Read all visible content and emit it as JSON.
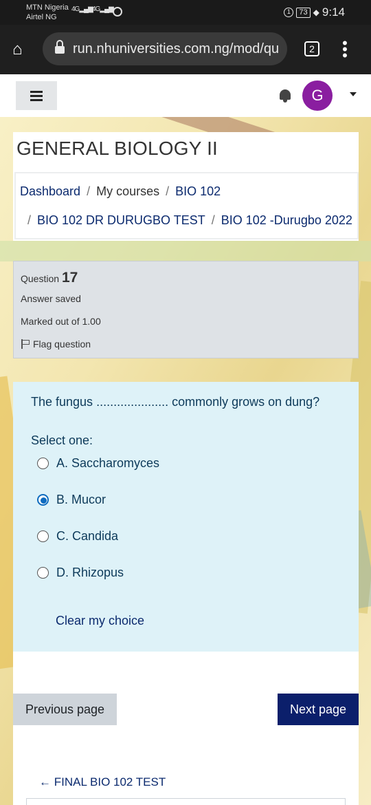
{
  "status_bar": {
    "carrier1": "MTN Nigeria",
    "carrier2": "Airtel NG",
    "signal1": "4G",
    "signal2": "4G",
    "battery": "73",
    "time": "9:14"
  },
  "browser": {
    "url": "run.nhuniversities.com.ng/mod/qu",
    "tab_count": "2"
  },
  "navbar": {
    "avatar_letter": "G"
  },
  "page": {
    "title": "GENERAL BIOLOGY II",
    "breadcrumb": [
      "Dashboard",
      "My courses",
      "BIO 102",
      "BIO 102 DR DURUGBO TEST",
      "BIO 102 -Durugbo 2022"
    ]
  },
  "question_info": {
    "label": "Question",
    "number": "17",
    "state": "Answer saved",
    "grade": "Marked out of 1.00",
    "flag": "Flag question"
  },
  "question": {
    "text": "The fungus ..................... commonly grows on dung?",
    "prompt": "Select one:",
    "options": [
      {
        "label": "A. Saccharomyces",
        "selected": false
      },
      {
        "label": "B. Mucor",
        "selected": true
      },
      {
        "label": "C. Candida",
        "selected": false
      },
      {
        "label": "D. Rhizopus",
        "selected": false
      }
    ],
    "clear": "Clear my choice"
  },
  "navigation": {
    "previous": "Previous page",
    "next": "Next page",
    "previous_activity": "FINAL BIO 102 TEST",
    "previous_activity_arrow": "←"
  },
  "colors": {
    "accent": "#0f6cbf",
    "link": "#0b2a6e",
    "next_button": "#0b1f6b",
    "avatar": "#8a1ea0",
    "question_bg": "#def2f8"
  }
}
